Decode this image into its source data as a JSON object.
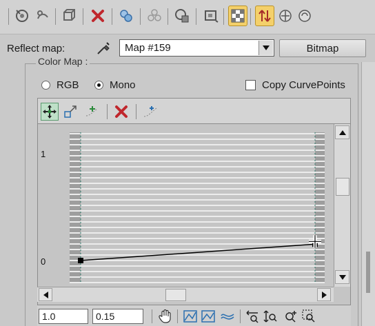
{
  "toolbar": {
    "icons": [
      "paste-icon",
      "copy-icon",
      "cube-icon",
      "delete-icon",
      "assign-icon",
      "pick-icon",
      "sphere-map-icon",
      "video-check-icon",
      "show-map-icon",
      "material-id-icon",
      "pick-material-icon",
      "options-icon"
    ]
  },
  "reflect": {
    "label": "Reflect map:",
    "map_value": "Map #159",
    "type_button": "Bitmap"
  },
  "group": {
    "title": "Color Map :",
    "radio_rgb": "RGB",
    "radio_mono": "Mono",
    "selected": "Mono",
    "copy_curvepoints": "Copy CurvePoints",
    "copy_checked": false
  },
  "curve": {
    "y_top_label": "1",
    "y_bottom_label": "0",
    "points": [
      {
        "x": 0.0,
        "y": 0.0
      },
      {
        "x": 1.0,
        "y": 0.15
      }
    ]
  },
  "bottom": {
    "x_value": "1.0",
    "y_value": "0.15"
  },
  "colors": {
    "accent_active": "#f4d06a",
    "delete_red": "#c0272d",
    "curve_line": "#000000"
  }
}
